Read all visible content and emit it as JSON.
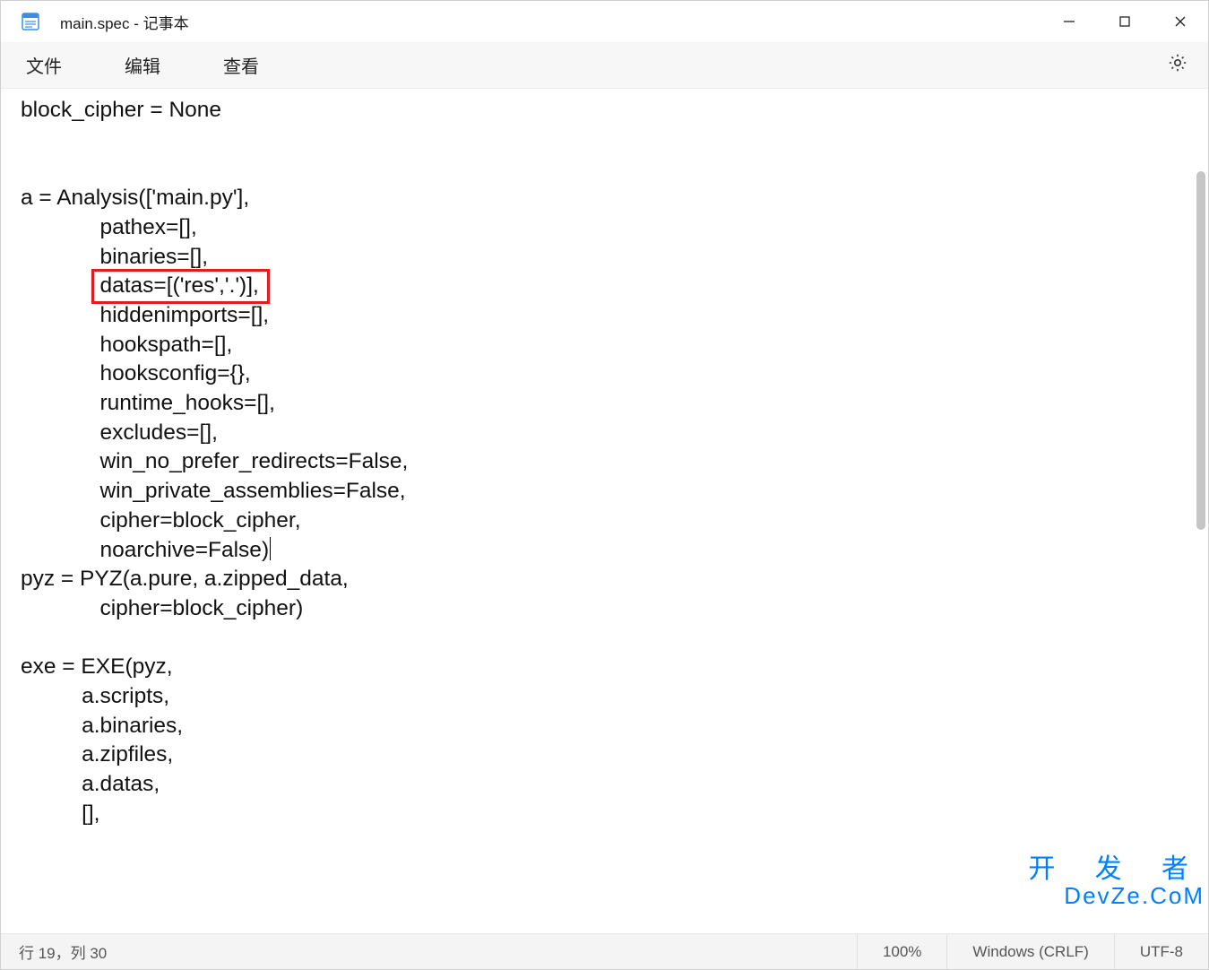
{
  "titlebar": {
    "title": "main.spec - 记事本"
  },
  "menubar": {
    "items": [
      "文件",
      "编辑",
      "查看"
    ]
  },
  "editor": {
    "lines": [
      "block_cipher = None",
      "",
      "",
      "a = Analysis(['main.py'],",
      "             pathex=[],",
      "             binaries=[],",
      "             datas=[('res','.')],",
      "             hiddenimports=[],",
      "             hookspath=[],",
      "             hooksconfig={},",
      "             runtime_hooks=[],",
      "             excludes=[],",
      "             win_no_prefer_redirects=False,",
      "             win_private_assemblies=False,",
      "             cipher=block_cipher,",
      "             noarchive=False)",
      "pyz = PYZ(a.pure, a.zipped_data,",
      "             cipher=block_cipher)",
      "",
      "exe = EXE(pyz,",
      "          a.scripts,",
      "          a.binaries,",
      "          a.zipfiles,",
      "          a.datas,",
      "          [],"
    ],
    "highlight_line_index": 6,
    "caret_after_line_index": 15
  },
  "statusbar": {
    "position": "行 19，列 30",
    "zoom": "100%",
    "line_ending": "Windows (CRLF)",
    "encoding": "UTF-8"
  },
  "watermark": {
    "top": "开 发 者",
    "bottom": "DevZe.CoM"
  },
  "colors": {
    "highlight_border": "#e11d1d",
    "watermark": "#0080ff"
  }
}
